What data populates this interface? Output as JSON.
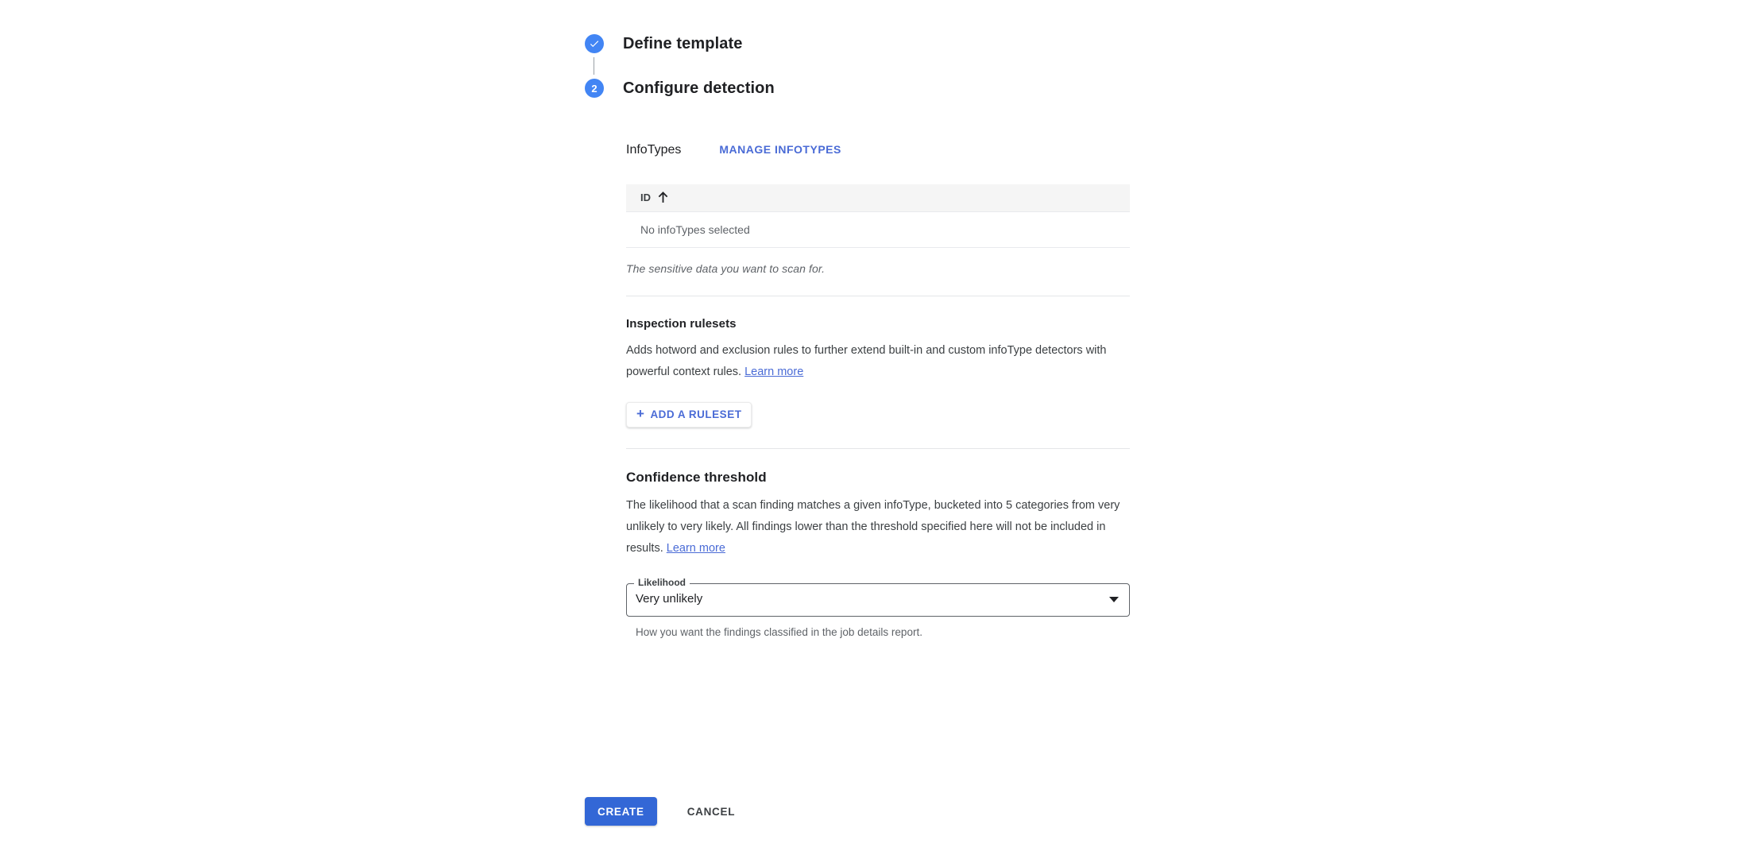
{
  "stepper": {
    "steps": [
      {
        "marker": "check-icon",
        "label": "Define template",
        "state": "completed"
      },
      {
        "marker": "2",
        "label": "Configure detection",
        "state": "active"
      }
    ]
  },
  "infotypes": {
    "label": "InfoTypes",
    "manage_button": "MANAGE INFOTYPES",
    "table": {
      "columns": [
        "ID"
      ],
      "sort_column": "ID",
      "sort_direction": "ascending",
      "rows": [],
      "empty_message": "No infoTypes selected"
    },
    "hint": "The sensitive data you want to scan for."
  },
  "rulesets": {
    "title": "Inspection rulesets",
    "description": "Adds hotword and exclusion rules to further extend built-in and custom infoType detectors with powerful context rules.",
    "learn_more": "Learn more",
    "add_button": "ADD A RULESET",
    "add_button_icon": "plus-icon"
  },
  "confidence": {
    "title": "Confidence threshold",
    "description": "The likelihood that a scan finding matches a given infoType, bucketed into 5 categories from very unlikely to very likely. All findings lower than the threshold specified here will not be included in results.",
    "learn_more": "Learn more",
    "select": {
      "label": "Likelihood",
      "value": "Very unlikely",
      "arrow_icon": "chevron-down-icon"
    },
    "hint": "How you want the findings classified in the job details report."
  },
  "actions": {
    "create": "CREATE",
    "cancel": "CANCEL"
  },
  "colors": {
    "accent_blue": "#4285f4",
    "link_blue": "#4a6bd6",
    "primary_button": "#3367d6",
    "table_header_bg": "#f5f5f5",
    "divider": "#e4e6e8",
    "muted_text": "#5f6368"
  }
}
